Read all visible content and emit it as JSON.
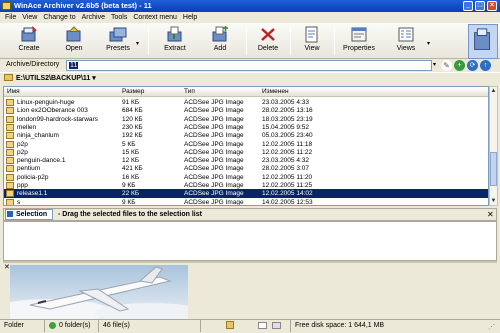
{
  "window": {
    "title": "WinAce Archiver v2.6b5 (beta test) - 11"
  },
  "menu": [
    "File",
    "View",
    "Change to",
    "Archive",
    "Tools",
    "Context menu",
    "Help"
  ],
  "toolbar": {
    "create": "Create",
    "open": "Open",
    "presets": "Presets",
    "extract": "Extract",
    "add": "Add",
    "delete": "Delete",
    "view": "View",
    "properties": "Properties",
    "views": "Views"
  },
  "address": {
    "label": "Archive/Directory",
    "value": "11"
  },
  "path": "E:\\UTILS2\\BACKUP\\11",
  "list": {
    "columns": [
      "Имя",
      "Размер",
      "Тип",
      "Изменен"
    ],
    "rows": [
      {
        "name": "Linux-penguin-huge",
        "size": "91 КБ",
        "type": "ACDSee JPG Image",
        "modified": "23.03.2005 4:33"
      },
      {
        "name": "Lion ex2OOberance 003",
        "size": "684 КБ",
        "type": "ACDSee JPG Image",
        "modified": "28.02.2005 13:16"
      },
      {
        "name": "london99-hardrock-starwars",
        "size": "120 КБ",
        "type": "ACDSee JPG Image",
        "modified": "18.03.2005 23:19"
      },
      {
        "name": "mellen",
        "size": "230 КБ",
        "type": "ACDSee JPG Image",
        "modified": "15.04.2005 9:52"
      },
      {
        "name": "ninja_chanlum",
        "size": "192 КБ",
        "type": "ACDSee JPG Image",
        "modified": "05.03.2005 23:40"
      },
      {
        "name": "p2p",
        "size": "5 КБ",
        "type": "ACDSee JPG Image",
        "modified": "12.02.2005 11:18"
      },
      {
        "name": "p2p",
        "size": "15 КБ",
        "type": "ACDSee JPG Image",
        "modified": "12.02.2005 11:22"
      },
      {
        "name": "penguin-dance.1",
        "size": "12 КБ",
        "type": "ACDSee JPG Image",
        "modified": "23.03.2005 4:32"
      },
      {
        "name": "pentium",
        "size": "421 КБ",
        "type": "ACDSee JPG Image",
        "modified": "28.02.2005 3:07"
      },
      {
        "name": "policia-p2p",
        "size": "16 КБ",
        "type": "ACDSee JPG Image",
        "modified": "12.02.2005 11:20"
      },
      {
        "name": "ppp",
        "size": "9 КБ",
        "type": "ACDSee JPG Image",
        "modified": "12.02.2005 11:25"
      },
      {
        "name": "release1.1",
        "size": "22 КБ",
        "type": "ACDSee JPG Image",
        "modified": "12.02.2005 14:02",
        "selected": true
      },
      {
        "name": "s",
        "size": "9 КБ",
        "type": "ACDSee JPG Image",
        "modified": "14.02.2005 12:53"
      }
    ]
  },
  "selection": {
    "button": "Selection",
    "hint": "- Drag the selected files to the selection list"
  },
  "status": {
    "mode": "Folder",
    "folders": "0 folder(s)",
    "files": "46 file(s)",
    "free": "Free disk space: 1 644,1 MB"
  },
  "colors": {
    "selected_row": "#0a246a",
    "title_bar": "#0a3fb4"
  }
}
